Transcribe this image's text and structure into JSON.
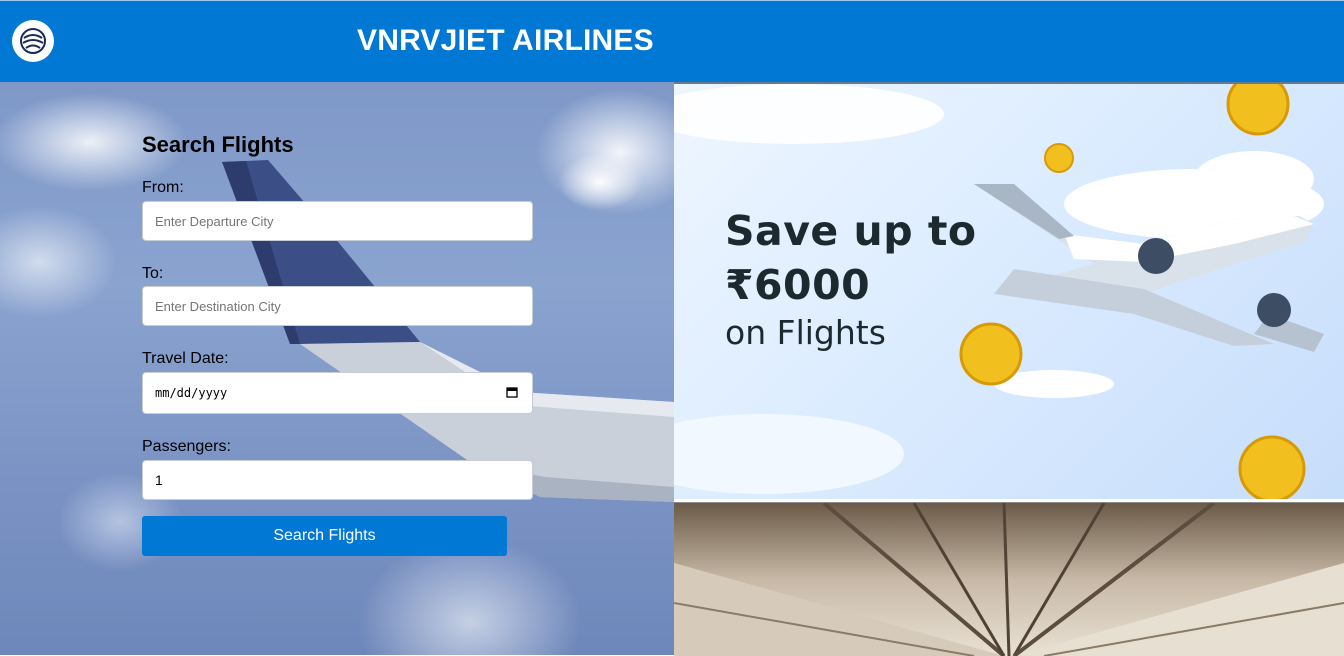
{
  "header": {
    "logo_icon": "airline-globe-logo-icon",
    "title": "VNRVJIET AIRLINES"
  },
  "search_form": {
    "heading": "Search Flights",
    "from_label": "From:",
    "from_placeholder": "Enter Departure City",
    "to_label": "To:",
    "to_placeholder": "Enter Destination City",
    "date_label": "Travel Date:",
    "date_placeholder": "mm/dd/yyyy",
    "passengers_label": "Passengers:",
    "passengers_value": "1",
    "submit_label": "Search Flights"
  },
  "promo": {
    "headline_line1": "Save up to",
    "headline_line2": "₹6000",
    "subline": "on Flights"
  },
  "colors": {
    "primary": "#0078d4",
    "text": "#000000"
  }
}
